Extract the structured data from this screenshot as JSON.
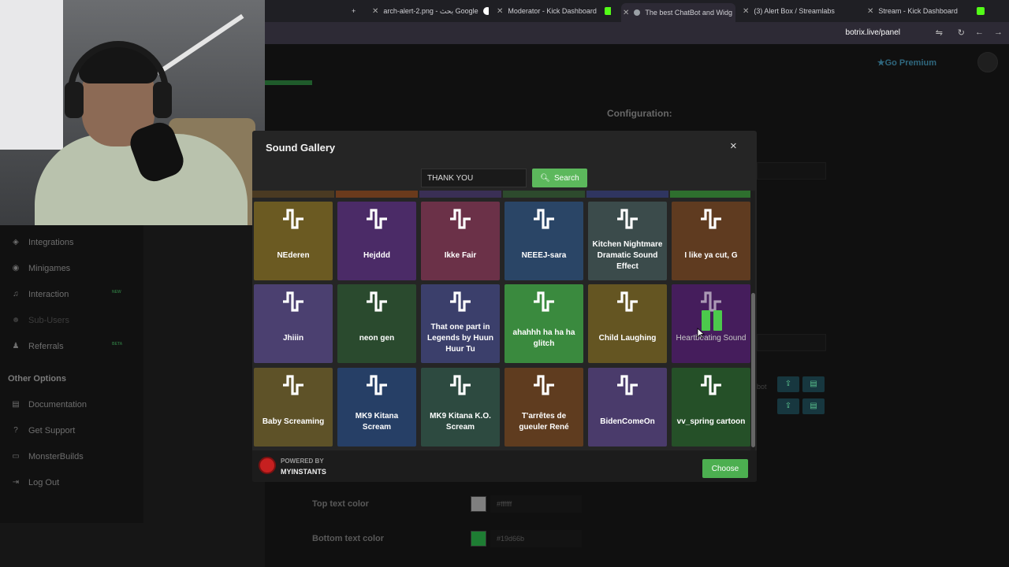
{
  "browser": {
    "tabs": [
      {
        "title": "arch-alert-2.png - بحث Google",
        "color": "#4285f4"
      },
      {
        "title": "Moderator - Kick Dashboard",
        "color": "#53fc18"
      },
      {
        "title": "The best ChatBot and Widg",
        "color": "#9aa0a6"
      },
      {
        "title": "(3) Alert Box / Streamlabs",
        "color": "#80f5d2"
      },
      {
        "title": "Stream - Kick Dashboard",
        "color": "#53fc18"
      }
    ],
    "new_tab_label": "+",
    "url": "botrix.live/panel"
  },
  "page": {
    "go_premium": "Go Premium",
    "config_title": "Configuration:",
    "sidebar": {
      "items": [
        {
          "label": "Integrations",
          "icon": "layers-icon"
        },
        {
          "label": "Minigames",
          "icon": "gamepad-icon",
          "badge": "NEW"
        },
        {
          "label": "Interaction",
          "icon": "music-icon"
        },
        {
          "label": "Sub-Users",
          "icon": "users-icon"
        },
        {
          "label": "Referrals",
          "icon": "user-group-icon",
          "badge": "BETA"
        }
      ],
      "other_options_heading": "Other Options",
      "other_items": [
        {
          "label": "Documentation",
          "icon": "document-icon"
        },
        {
          "label": "Get Support",
          "icon": "question-icon"
        },
        {
          "label": "MonsterBuilds",
          "icon": "monitor-icon"
        },
        {
          "label": "Log Out",
          "icon": "logout-icon"
        }
      ]
    },
    "fields": [
      {
        "label": "Top text color",
        "value": "#ffffff",
        "swatch": "#aaaaaa"
      },
      {
        "label": "Bottom text color",
        "value": "#19d66b",
        "swatch": "#28a745"
      }
    ],
    "partial_text": "bot"
  },
  "modal": {
    "title": "Sound Gallery",
    "close_label": "×",
    "search_value": "THANK YOU",
    "search_button": "Search",
    "choose_button": "Choose",
    "powered_by": "POWERED BY",
    "provider": "MYINSTANTS",
    "peek_colors": [
      "#4a3a22",
      "#6a3a1c",
      "#3a2f55",
      "#2d4a2d",
      "#2f3560",
      "#2e6f2e"
    ],
    "sounds": [
      {
        "name": "NEderen",
        "color": "#6b5a22"
      },
      {
        "name": "Hejddd",
        "color": "#4b2b67"
      },
      {
        "name": "Ikke Fair",
        "color": "#6b3148"
      },
      {
        "name": "NEEEJ-sara",
        "color": "#2a4566"
      },
      {
        "name": "Kitchen Nightmare Dramatic Sound Effect",
        "color": "#3b4b4b"
      },
      {
        "name": "I like ya cut, G",
        "color": "#5f3b20"
      },
      {
        "name": "Jhiiin",
        "color": "#4b4070"
      },
      {
        "name": "neon gen",
        "color": "#2a4a2e"
      },
      {
        "name": "That one part in Legends by Huun Huur Tu",
        "color": "#3b3f6b"
      },
      {
        "name": "ahahhh ha ha ha glitch",
        "color": "#3a8a3e"
      },
      {
        "name": "Child Laughing",
        "color": "#645522"
      },
      {
        "name": "Heartbeating Sound",
        "color": "#451d5c",
        "playing": true
      },
      {
        "name": "Baby Screaming",
        "color": "#5e5228"
      },
      {
        "name": "MK9 Kitana Scream",
        "color": "#263f66"
      },
      {
        "name": "MK9 Kitana K.O. Scream",
        "color": "#2d4a40"
      },
      {
        "name": "T'arrêtes de gueuler René",
        "color": "#5f3c1f"
      },
      {
        "name": "BidenComeOn",
        "color": "#4a3b6b"
      },
      {
        "name": "vv_spring cartoon",
        "color": "#255028"
      }
    ]
  }
}
